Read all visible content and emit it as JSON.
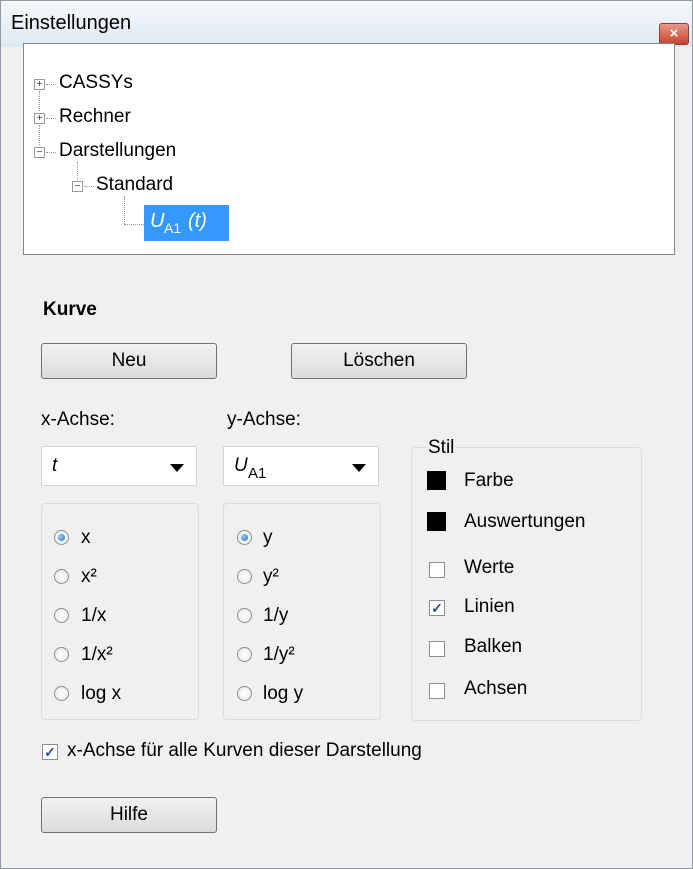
{
  "window": {
    "title": "Einstellungen",
    "close_icon": "close-icon"
  },
  "tree": {
    "items": [
      {
        "label": "CASSYs",
        "expander": "+"
      },
      {
        "label": "Rechner",
        "expander": "+"
      },
      {
        "label": "Darstellungen",
        "expander": "−"
      },
      {
        "label": "Standard",
        "expander": "−"
      }
    ],
    "selected": {
      "symbol": "U",
      "subscript": "A1",
      "arg": "(t)"
    }
  },
  "kurve": {
    "title": "Kurve",
    "new_label": "Neu",
    "delete_label": "Löschen"
  },
  "x_axis": {
    "label": "x-Achse:",
    "value": "t",
    "options": [
      "x",
      "x²",
      "1/x",
      "1/x²",
      "log x"
    ],
    "selected": 0
  },
  "y_axis": {
    "label": "y-Achse:",
    "value_symbol": "U",
    "value_subscript": "A1",
    "options": [
      "y",
      "y²",
      "1/y",
      "1/y²",
      "log y"
    ],
    "selected": 0
  },
  "stil": {
    "title": "Stil",
    "color_label": "Farbe",
    "eval_label": "Auswertungen",
    "checks": [
      {
        "label": "Werte",
        "checked": false
      },
      {
        "label": "Linien",
        "checked": true
      },
      {
        "label": "Balken",
        "checked": false
      },
      {
        "label": "Achsen",
        "checked": false
      }
    ],
    "swatch_color": "#000000"
  },
  "shared_x": {
    "label": "x-Achse für alle Kurven dieser Darstellung",
    "checked": true
  },
  "help_label": "Hilfe"
}
